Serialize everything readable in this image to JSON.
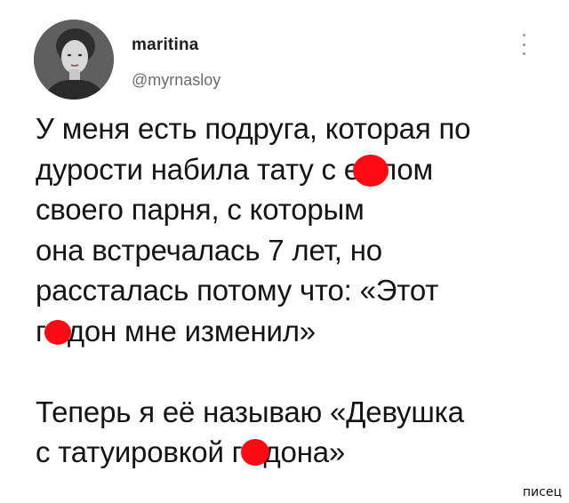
{
  "tweet": {
    "display_name": "maritina",
    "handle": "@myrnasloy",
    "lines": [
      "У меня есть подруга, которая по",
      "дурости набила тату с е",
      "своего парня, с которым",
      "она встречалась 7 лет, но",
      "рассталась потому что: «Этот",
      "г",
      "Теперь я её называю «Девушка",
      "с татуировкой г"
    ],
    "line2_tail": "лом",
    "line6_tail": "дон мне изменил»",
    "line8_tail": "дона»"
  },
  "icons": {
    "more": "more-vertical-icon",
    "censor": "red-censor-blob"
  },
  "colors": {
    "censor": "#ff0a14",
    "text": "#141414",
    "handle": "#6b6b6b"
  },
  "watermark": "писец"
}
